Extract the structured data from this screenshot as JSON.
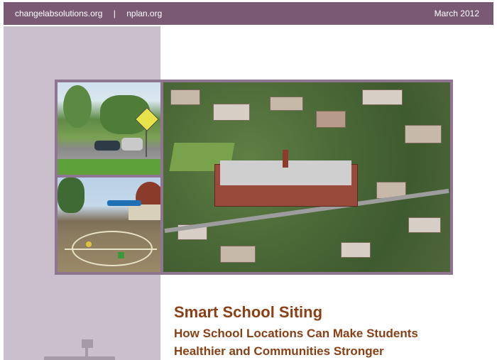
{
  "header": {
    "links": [
      "changelabsolutions.org",
      "nplan.org"
    ],
    "separator": "|",
    "date": "March 2012"
  },
  "photos": [
    {
      "subject": "school crossing sign and street"
    },
    {
      "subject": "school playground"
    },
    {
      "subject": "aerial view of school in neighborhood"
    }
  ],
  "cover": {
    "title": "Smart School Siting",
    "subtitle_line1": "How School Locations Can Make Students",
    "subtitle_line2": "Healthier and Communities Stronger"
  },
  "colors": {
    "topbar": "#7a5a73",
    "left_band": "#c9bfcd",
    "frame": "#8e7590",
    "title": "#8a4016"
  },
  "icons": [
    "organization-logo-icon"
  ]
}
